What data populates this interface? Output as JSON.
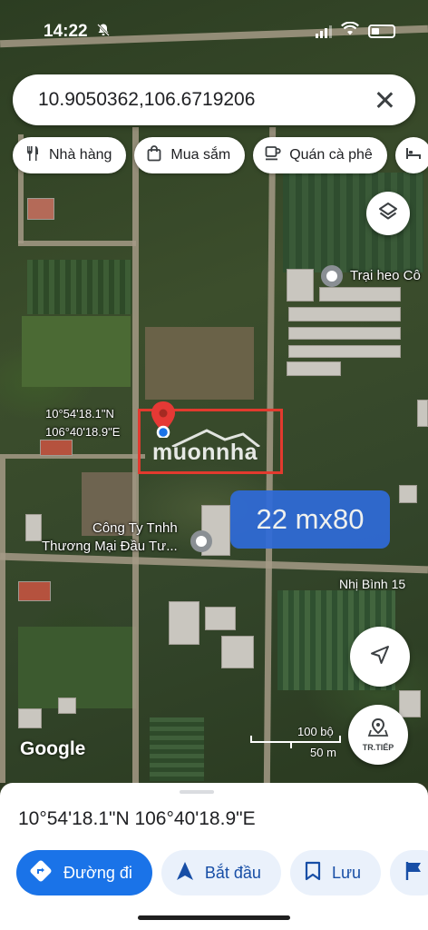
{
  "status_bar": {
    "time": "14:22",
    "mute_icon": "bell-slash-icon"
  },
  "search": {
    "query": "10.9050362,106.6719206",
    "clear_icon": "close-icon"
  },
  "chips": [
    {
      "label": "Nhà hàng",
      "icon": "fork-knife-icon"
    },
    {
      "label": "Mua sắm",
      "icon": "shopping-bag-icon"
    },
    {
      "label": "Quán cà phê",
      "icon": "coffee-cup-icon"
    }
  ],
  "map": {
    "poi_trai_heo": "Trại heo Cô",
    "poi_company_line1": "Công Ty Tnhh",
    "poi_company_line2": "Thương Mại Đầu Tư...",
    "pin_coord_line1": "10°54'18.1\"N",
    "pin_coord_line2": "106°40'18.9\"E",
    "watermark": "muonnha",
    "plot_size": "22 mx80",
    "street_name": "Nhị Bình 15",
    "attribution": "Google",
    "scale_top": "100 bộ",
    "scale_bottom": "50 m",
    "directions_fab_label": "TR.TIẾP"
  },
  "place_sheet": {
    "title": "10°54'18.1\"N 106°40'18.9\"E",
    "actions": [
      {
        "label": "Đường đi",
        "icon": "directions-icon"
      },
      {
        "label": "Bắt đầu",
        "icon": "navigation-arrow-icon"
      },
      {
        "label": "Lưu",
        "icon": "bookmark-icon"
      }
    ]
  },
  "colors": {
    "accent": "#1a73e8",
    "plot_outline": "#e23a2e",
    "size_box": "#2f6bd9"
  }
}
